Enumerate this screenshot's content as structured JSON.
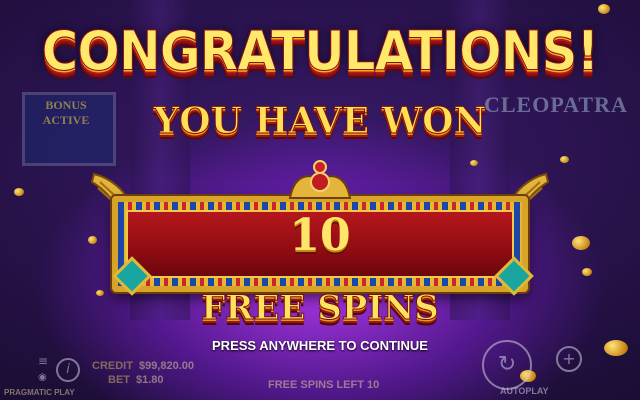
{
  "game": {
    "logo": "CLEOPATRA",
    "bonus_label_1": "BONUS",
    "bonus_label_2": "ACTIVE",
    "provider": "PRAGMATIC PLAY"
  },
  "popup": {
    "title": "CONGRATULATIONS!",
    "subtitle": "YOU HAVE WON",
    "count": "10",
    "prize_label": "FREE SPINS",
    "instruction": "PRESS ANYWHERE TO CONTINUE"
  },
  "status": {
    "credit_label": "CREDIT",
    "credit_value": "$99,820.00",
    "bet_label": "BET",
    "bet_value": "$1.80",
    "free_spins_left": "FREE SPINS LEFT 10"
  },
  "controls": {
    "autoplay": "AUTOPLAY",
    "info_icon": "info-icon",
    "menu_icon": "menu-icon",
    "sound_icon": "sound-icon",
    "spin_icon": "spin-icon",
    "plus_icon": "plus-icon"
  },
  "colors": {
    "gold": "#ffe46a",
    "red_panel": "#b5171b",
    "purple_glow": "#be3cff",
    "turquoise": "#19a6a0"
  }
}
